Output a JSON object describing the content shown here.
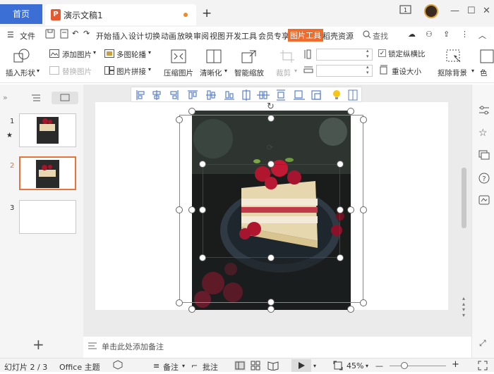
{
  "titlebar": {
    "home_tab": "首页",
    "doc_tab_title": "演示文稿1",
    "doc_icon_letter": "P",
    "new_tab": "+",
    "unread_badge": "1"
  },
  "menubar": {
    "file": "文件",
    "items": [
      "开始",
      "插入",
      "设计",
      "切换",
      "动画",
      "放映",
      "审阅",
      "视图",
      "开发工具",
      "会员专享",
      "图片工具",
      "稻壳资源"
    ],
    "active_item": "图片工具",
    "search": "查找"
  },
  "ribbon": {
    "insert_shape": "插入形状",
    "add_picture": "添加图片",
    "replace_picture": "替换图片",
    "multi_carousel": "多图轮播",
    "picture_splice": "图片拼接",
    "compress_picture": "压缩图片",
    "sharpen": "清晰化",
    "smart_zoom": "智能缩放",
    "crop": "裁剪",
    "lock_ratio": "锁定纵横比",
    "lock_ratio_checked": true,
    "reset_size": "重设大小",
    "remove_background": "抠除背景",
    "more": "色"
  },
  "left_panel": {
    "slides": [
      {
        "number": "1",
        "star": "★"
      },
      {
        "number": "2"
      },
      {
        "number": "3"
      }
    ],
    "add_slide": "+"
  },
  "notes": {
    "placeholder": "单击此处添加备注"
  },
  "statusbar": {
    "slide_info": "幻灯片 2 / 3",
    "theme": "Office 主题",
    "notes_btn": "备注",
    "comments_btn": "批注",
    "zoom": "45%",
    "zoom_fraction": 0.5
  },
  "colors": {
    "accent_blue": "#3b6fd6",
    "accent_orange": "#f36b2a",
    "selection_orange": "#e8743b"
  }
}
